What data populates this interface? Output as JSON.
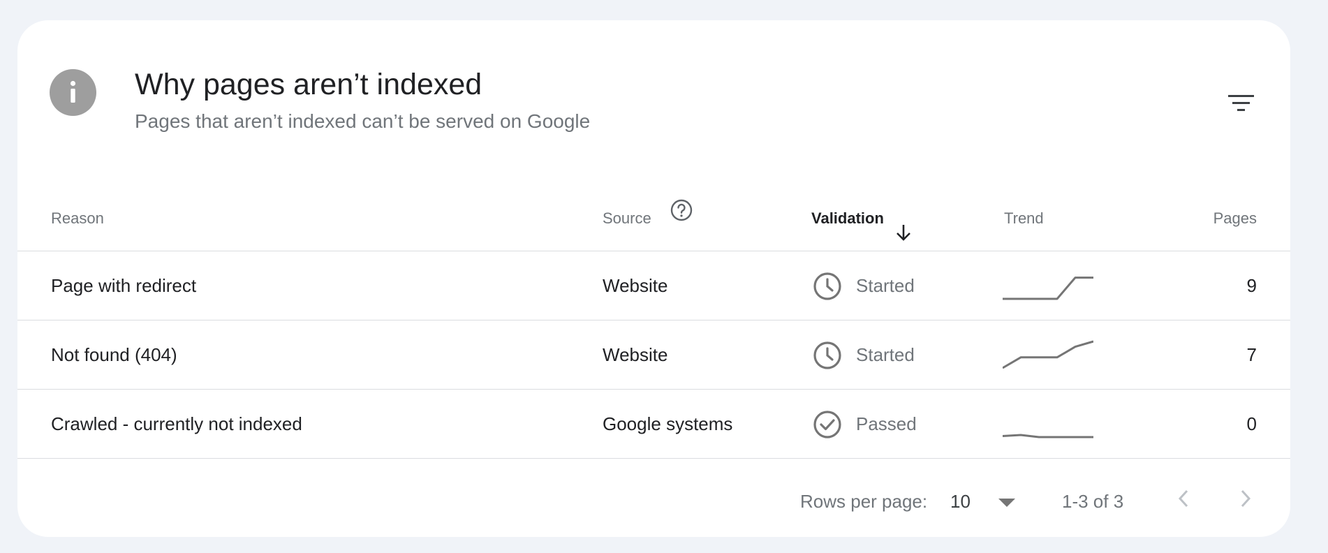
{
  "header": {
    "icon": "info-icon",
    "title": "Why pages aren’t indexed",
    "subtitle": "Pages that aren’t indexed can’t be served on Google",
    "filter_icon": "filter-icon"
  },
  "table": {
    "columns": {
      "reason": "Reason",
      "source": "Source",
      "validation": "Validation",
      "trend": "Trend",
      "pages": "Pages"
    },
    "source_help_icon": "help-circle-icon",
    "sort_icon": "arrow-down-icon",
    "rows": [
      {
        "reason": "Page with redirect",
        "source": "Website",
        "status": "Started",
        "status_icon": "clock-icon",
        "pages": "9",
        "trend": [
          0,
          0,
          0,
          0,
          2,
          2
        ]
      },
      {
        "reason": "Not found (404)",
        "source": "Website",
        "status": "Started",
        "status_icon": "clock-icon",
        "pages": "7",
        "trend": [
          0,
          1,
          1,
          1,
          2,
          2.5
        ]
      },
      {
        "reason": "Crawled - currently not indexed",
        "source": "Google systems",
        "status": "Passed",
        "status_icon": "check-circle-icon",
        "pages": "0",
        "trend": [
          0.1,
          0.2,
          0,
          0,
          0,
          0
        ]
      }
    ]
  },
  "pagination": {
    "rows_per_page_label": "Rows per page:",
    "rows_per_page_value": "10",
    "range": "1-3 of 3",
    "prev_icon": "chevron-left-icon",
    "next_icon": "chevron-right-icon"
  },
  "colors": {
    "background": "#f0f3f8",
    "card": "#ffffff",
    "icon_grey": "#9e9e9e",
    "text_primary": "#202124",
    "text_secondary": "#70757a",
    "divider": "#dadce0",
    "trend_line": "#757575"
  }
}
